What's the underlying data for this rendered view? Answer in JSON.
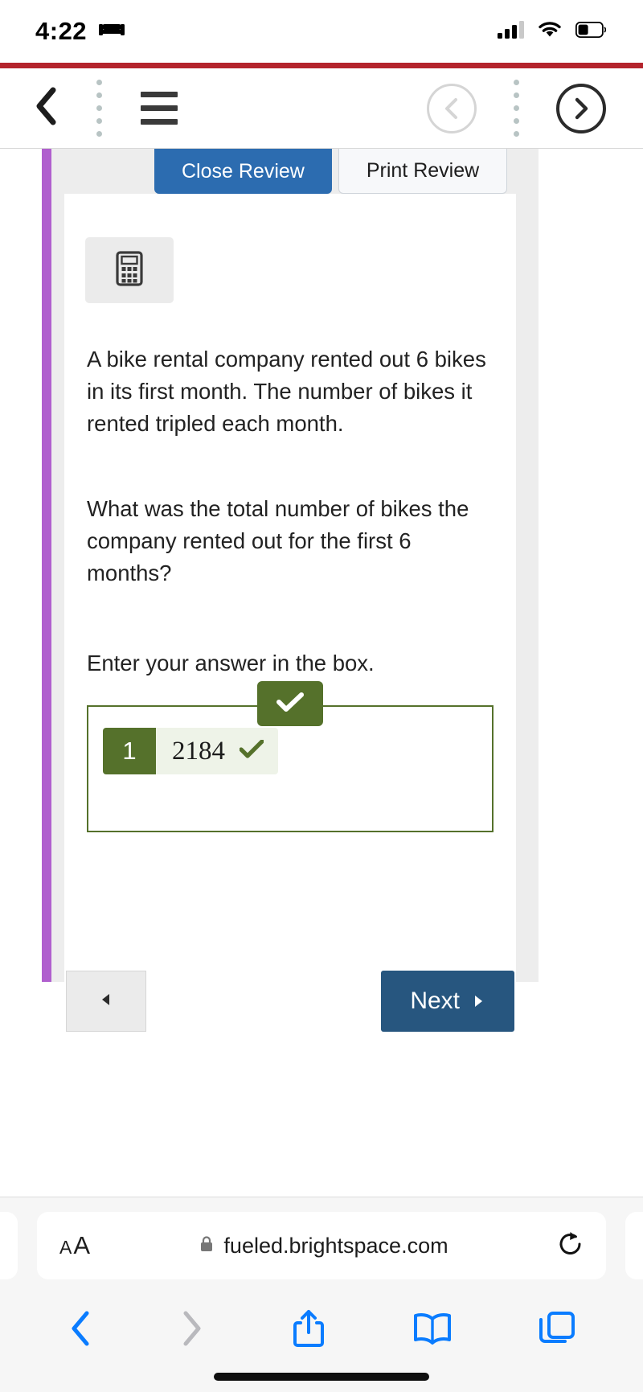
{
  "status_bar": {
    "time": "4:22",
    "focus_icon": "bed-icon",
    "cellular_icon": "signal-bars-icon",
    "wifi_icon": "wifi-icon",
    "battery_icon": "battery-icon",
    "signal_bars_filled": 3,
    "signal_bars_total": 4
  },
  "app_toolbar": {
    "back_icon": "chevron-left-icon",
    "menu_icon": "hamburger-menu-icon",
    "prev_icon": "circled-chevron-left-icon",
    "next_icon": "circled-chevron-right-icon",
    "prev_enabled": false,
    "next_enabled": true,
    "accent_bar_color": "#b4242c"
  },
  "review": {
    "tabs": [
      {
        "label": "Close Review",
        "active": true
      },
      {
        "label": "Print Review",
        "active": false
      }
    ],
    "calculator_icon": "calculator-icon",
    "question_paragraph_1": "A bike rental company rented out 6 bikes in its first month. The number of bikes it rented tripled each month.",
    "question_paragraph_2": "What was the total number of bikes the company rented out for the first 6 months?",
    "answer_prompt": "Enter your answer in the box.",
    "answer": {
      "number_label": "1",
      "value": "2184",
      "correct": true,
      "check_icon": "checkmark-icon",
      "badge_icon": "checkmark-icon",
      "correct_color": "#55712b",
      "field_bg_color": "#eef3e8"
    },
    "prev_button": {
      "label": "",
      "icon": "triangle-left-icon"
    },
    "next_button": {
      "label": "Next",
      "icon": "triangle-right-icon",
      "color": "#27567f"
    },
    "rail_color": "#b05fce"
  },
  "browser": {
    "text_size_small": "A",
    "text_size_large": "A",
    "lock_icon": "lock-icon",
    "url": "fueled.brightspace.com",
    "reload_icon": "reload-icon",
    "back_icon": "chevron-left-icon",
    "forward_icon": "chevron-right-icon",
    "share_icon": "share-icon",
    "bookmarks_icon": "book-icon",
    "tabs_icon": "tabs-icon",
    "accent_color": "#0a7cff"
  }
}
